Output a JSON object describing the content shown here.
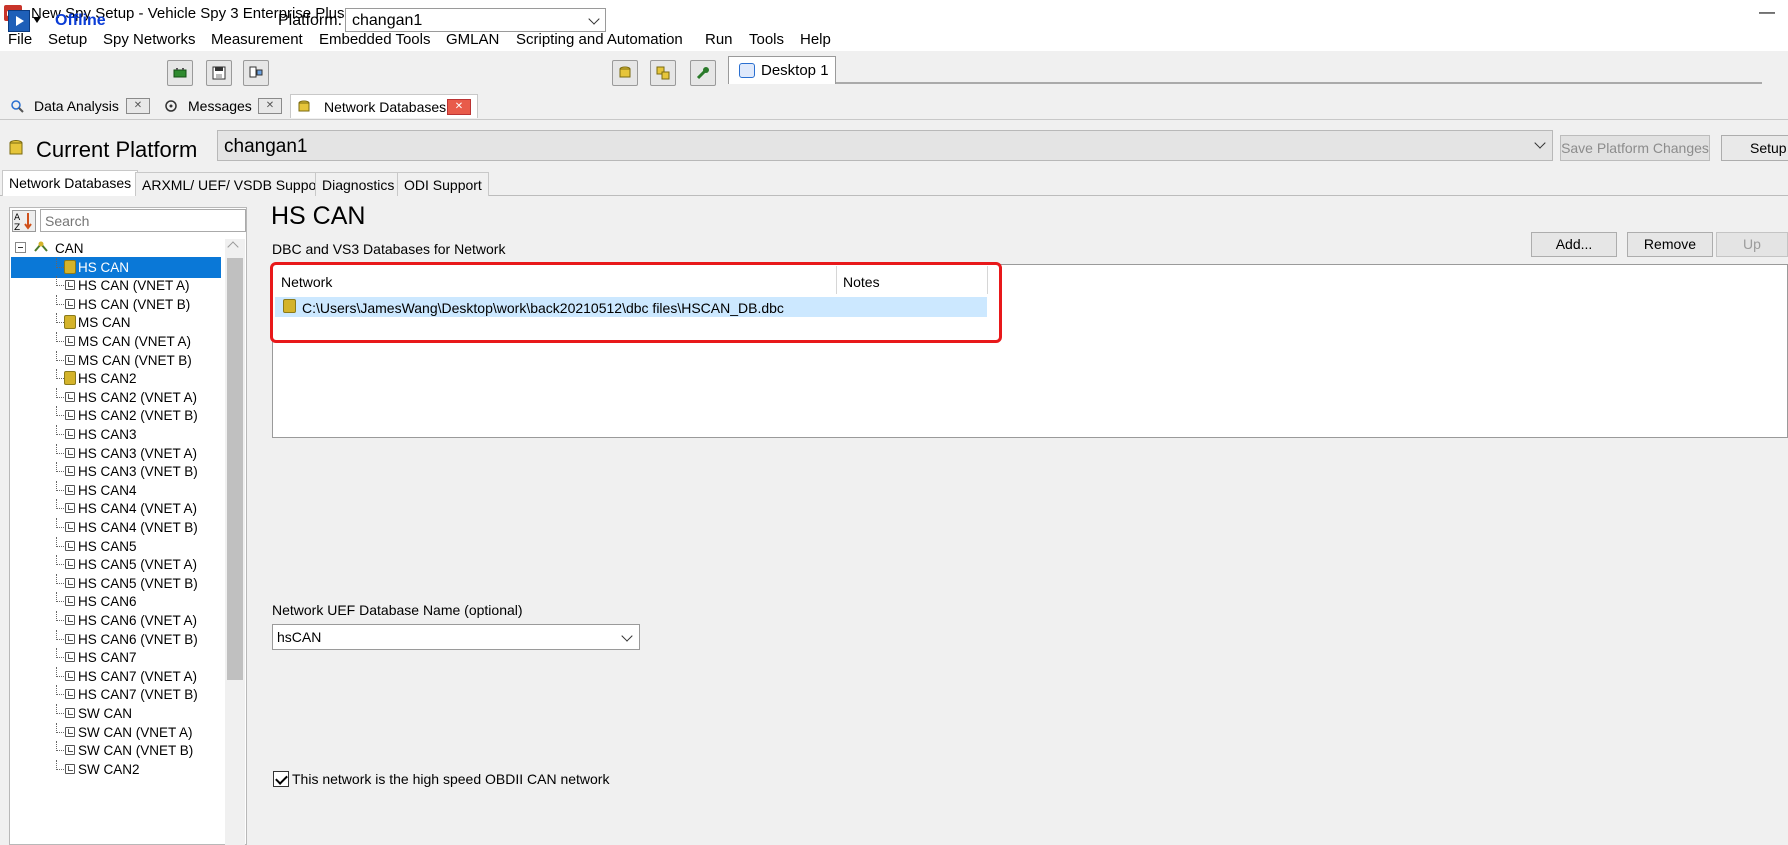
{
  "window": {
    "title": "New Spy Setup - Vehicle Spy 3 Enterprise Plus",
    "minimize": "—"
  },
  "menu": {
    "items": [
      "File",
      "Setup",
      "Spy Networks",
      "Measurement",
      "Embedded Tools",
      "GMLAN",
      "Scripting and Automation",
      "Run",
      "Tools",
      "Help"
    ]
  },
  "toolbar": {
    "status": "Offline",
    "platform_label": "Platform:",
    "platform_value": "changan1",
    "desktop_tab": "Desktop 1",
    "icons": [
      "play-icon",
      "chip-icon",
      "save-icon",
      "monitor-icon",
      "database-icon",
      "database-multi-icon",
      "wrench-icon",
      "desktop-icon"
    ]
  },
  "doc_tabs": {
    "items": [
      "Data Analysis",
      "Messages",
      "Network Databases"
    ]
  },
  "current_platform": {
    "label": "Current Platform",
    "value": "changan1",
    "save_label": "Save Platform Changes",
    "setup_label": "Setup"
  },
  "subtabs": {
    "items": [
      "Network Databases",
      "ARXML/ UEF/ VSDB Support",
      "Diagnostics",
      "ODI Support"
    ]
  },
  "tree": {
    "search_placeholder": "Search",
    "root": "CAN",
    "items": [
      "HS CAN",
      "HS CAN (VNET A)",
      "HS CAN (VNET B)",
      "MS CAN",
      "MS CAN (VNET A)",
      "MS CAN (VNET B)",
      "HS CAN2",
      "HS CAN2 (VNET A)",
      "HS CAN2 (VNET B)",
      "HS CAN3",
      "HS CAN3 (VNET A)",
      "HS CAN3 (VNET B)",
      "HS CAN4",
      "HS CAN4 (VNET A)",
      "HS CAN4 (VNET B)",
      "HS CAN5",
      "HS CAN5 (VNET A)",
      "HS CAN5 (VNET B)",
      "HS CAN6",
      "HS CAN6 (VNET A)",
      "HS CAN6 (VNET B)",
      "HS CAN7",
      "HS CAN7 (VNET A)",
      "HS CAN7 (VNET B)",
      "SW CAN",
      "SW CAN (VNET A)",
      "SW CAN (VNET B)",
      "SW CAN2"
    ],
    "selected": "HS CAN"
  },
  "detail": {
    "title": "HS CAN",
    "subtitle": "DBC and VS3 Databases for Network",
    "add_label": "Add...",
    "remove_label": "Remove",
    "up_label": "Up",
    "col_network": "Network",
    "col_notes": "Notes",
    "db_path": "C:\\Users\\JamesWang\\Desktop\\work\\back20210512\\dbc files\\HSCAN_DB.dbc",
    "uef_label": "Network UEF Database Name (optional)",
    "uef_value": "hsCAN",
    "obd_label": "This network is the high speed OBDII CAN network",
    "obd_checked": true
  },
  "colors": {
    "selection": "#0a78d7",
    "row_highlight": "#cce8ff",
    "annotation_box": "#e8181a",
    "offline_text": "#0a3cd6"
  }
}
